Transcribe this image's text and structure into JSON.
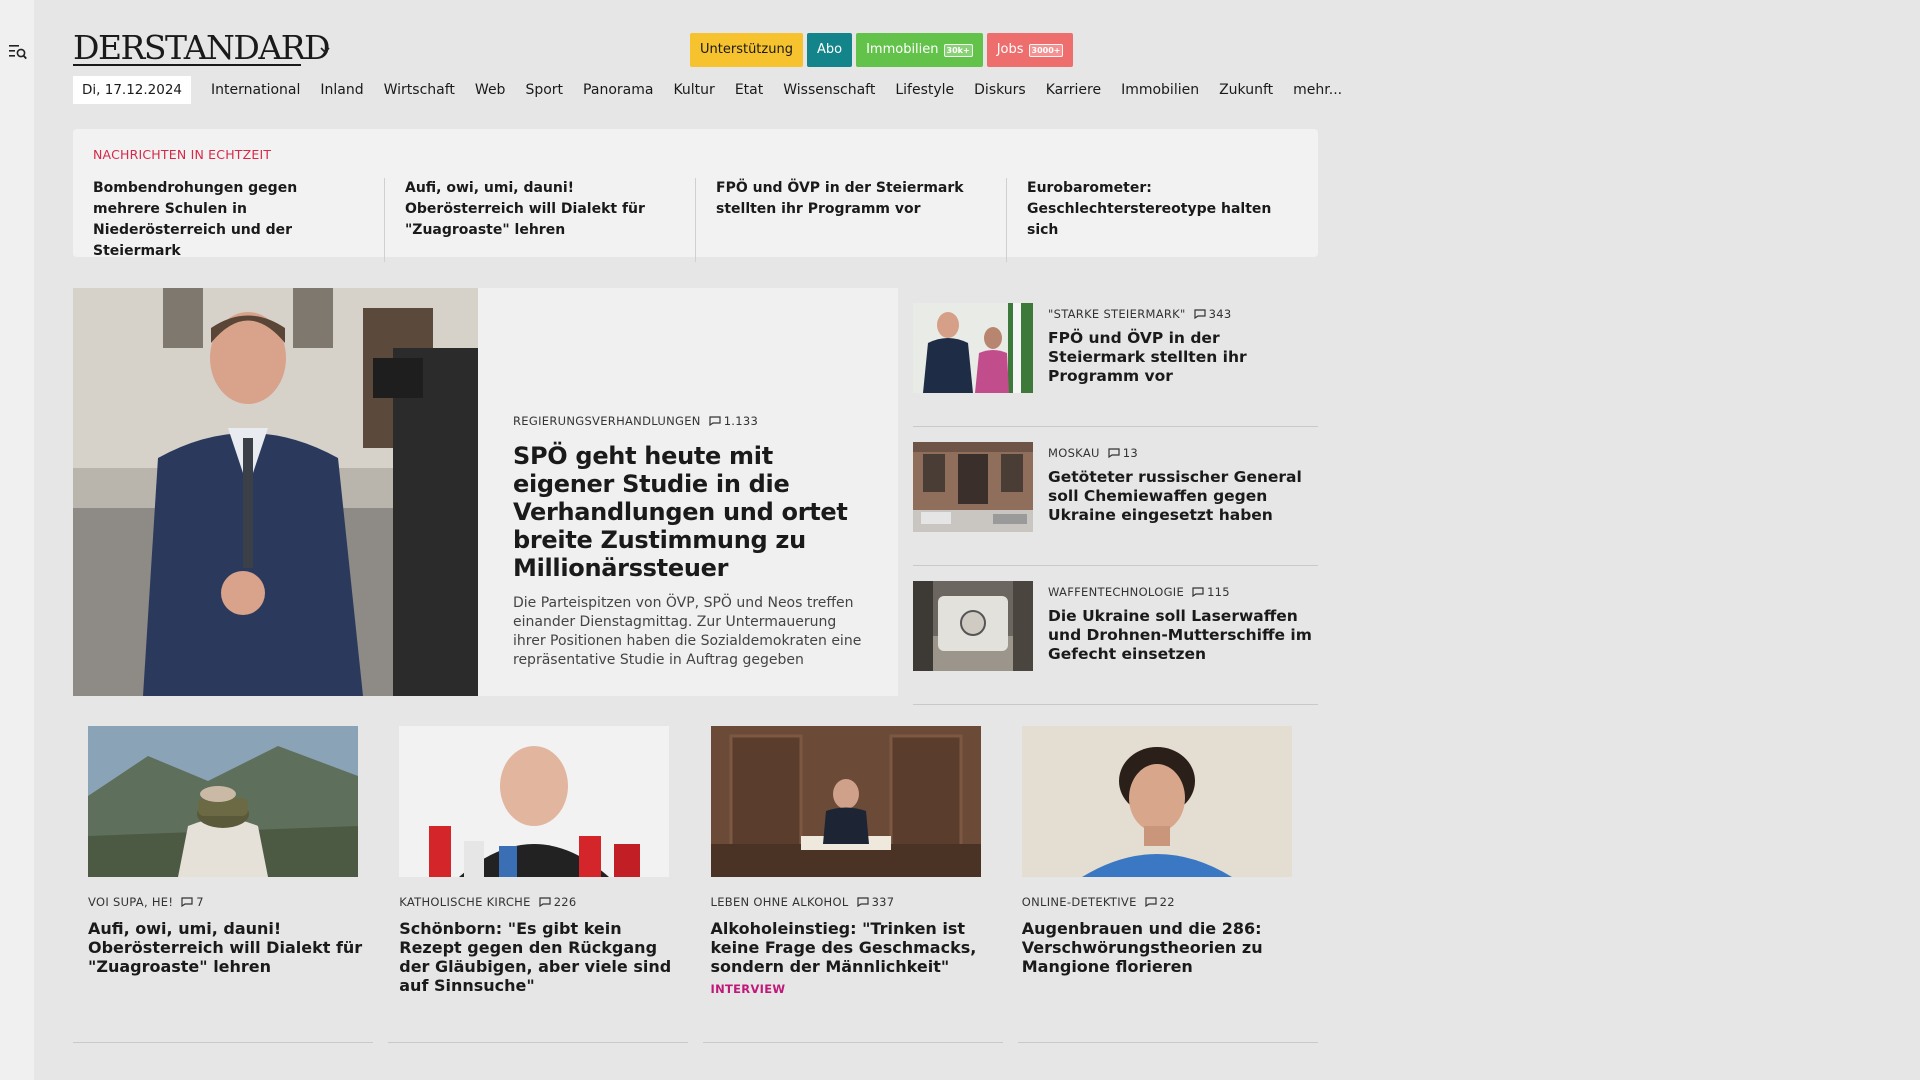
{
  "brand": {
    "logo": "DERSTANDARD"
  },
  "top_buttons": [
    {
      "label": "Unterstützung",
      "bg": "#f6c22e",
      "fg": "#1a1a1a",
      "count": ""
    },
    {
      "label": "Abo",
      "bg": "#14848b",
      "fg": "#ffffff",
      "count": ""
    },
    {
      "label": "Immobilien",
      "bg": "#62c24a",
      "fg": "#ffffff",
      "count": "30k+"
    },
    {
      "label": "Jobs",
      "bg": "#ee6e6e",
      "fg": "#ffffff",
      "count": "3000+"
    }
  ],
  "nav": {
    "date": "Di, 17.12.2024",
    "items": [
      "International",
      "Inland",
      "Wirtschaft",
      "Web",
      "Sport",
      "Panorama",
      "Kultur",
      "Etat",
      "Wissenschaft",
      "Lifestyle",
      "Diskurs",
      "Karriere",
      "Immobilien",
      "Zukunft",
      "mehr..."
    ]
  },
  "ticker": {
    "label": "NACHRICHTEN IN ECHTZEIT",
    "items": [
      "Bombendrohungen gegen mehrere Schulen in Niederösterreich und der Steiermark",
      "Aufi, owi, umi, dauni! Oberösterreich will Dialekt für \"Zuagroaste\" lehren",
      "FPÖ und ÖVP in der Steiermark stell­ten ihr Programm vor",
      "Eurobarometer: Geschlechterstereo­type halten sich"
    ]
  },
  "hero": {
    "kicker": "REGIERUNGSVERHANDLUNGEN",
    "comments": "1.133",
    "title": "SPÖ geht heute mit eigener Studie in die Verhandlungen und ortet breite Zustimmung zu Millionärssteuer",
    "lead": "Die Parteispitzen von ÖVP, SPÖ und Neos treffen einander Dienstagmittag. Zur Untermauerung ihrer Positionen haben die Sozialdemokraten eine repräsentative Studie in Auftrag gegeben"
  },
  "side_stories": [
    {
      "kicker": "\"STARKE STEIERMARK\"",
      "comments": "343",
      "title": "FPÖ und ÖVP in der Steiermark stellten ihr Programm vor"
    },
    {
      "kicker": "MOSKAU",
      "comments": "13",
      "title": "Getöteter russischer General soll Chemiewaffen gegen Ukraine eingesetzt haben"
    },
    {
      "kicker": "WAFFENTECHNOLOGIE",
      "comments": "115",
      "title": "Die Ukraine soll Laserwaffen und Drohnen-Mutterschiffe im Gefecht einsetzen"
    }
  ],
  "cards": [
    {
      "kicker": "VOI SUPA, HE!",
      "comments": "7",
      "title": "Aufi, owi, umi, dauni! Oberösterreich will Dialekt für \"Zuagroaste\" lehren",
      "tag": ""
    },
    {
      "kicker": "KATHOLISCHE KIRCHE",
      "comments": "226",
      "title": "Schönborn: \"Es gibt kein Rezept gegen den Rückgang der Gläubigen, aber viele sind auf Sinnsuche\"",
      "tag": ""
    },
    {
      "kicker": "LEBEN OHNE ALKOHOL",
      "comments": "337",
      "title": "Alkoholeinstieg: \"Trinken ist keine Frage des Geschmacks, sondern der Männlichkeit\"",
      "tag": "INTERVIEW"
    },
    {
      "kicker": "ONLINE-DETEKTIVE",
      "comments": "22",
      "title": "Augenbrauen und die 286: Ver­schwörungstheorien zu Mangione florieren",
      "tag": ""
    }
  ]
}
